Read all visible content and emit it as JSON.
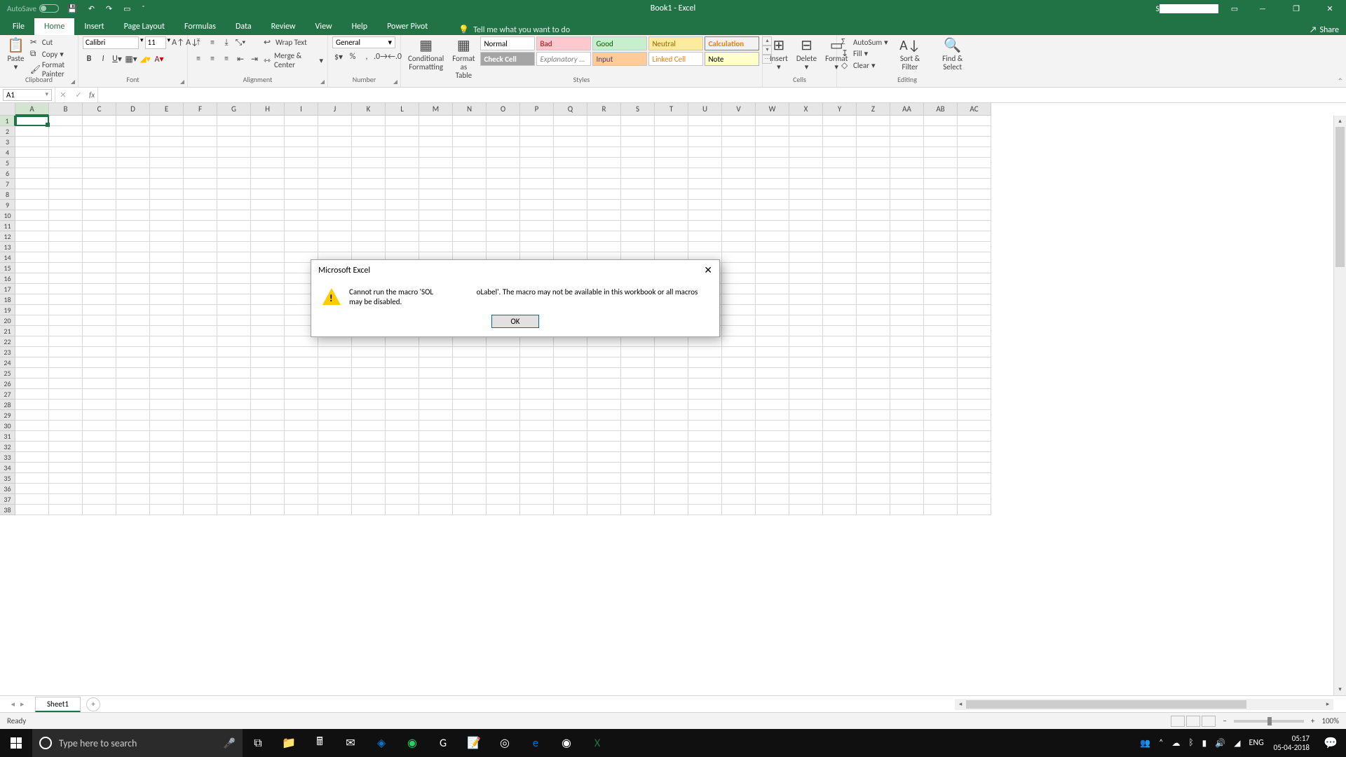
{
  "titlebar": {
    "autosave_label": "AutoSave",
    "title": "Book1 - Excel",
    "user_prefix": "S"
  },
  "tabs": {
    "file": "File",
    "home": "Home",
    "insert": "Insert",
    "page_layout": "Page Layout",
    "formulas": "Formulas",
    "data": "Data",
    "review": "Review",
    "view": "View",
    "help": "Help",
    "power_pivot": "Power Pivot",
    "tellme": "Tell me what you want to do",
    "share": "Share"
  },
  "ribbon": {
    "clipboard": {
      "label": "Clipboard",
      "paste": "Paste",
      "cut": "Cut",
      "copy": "Copy",
      "painter": "Format Painter"
    },
    "font": {
      "label": "Font",
      "name": "Calibri",
      "size": "11"
    },
    "alignment": {
      "label": "Alignment",
      "wrap": "Wrap Text",
      "merge": "Merge & Center"
    },
    "number": {
      "label": "Number",
      "format": "General"
    },
    "styles": {
      "label": "Styles",
      "cond": "Conditional Formatting",
      "table": "Format as Table",
      "normal": "Normal",
      "bad": "Bad",
      "good": "Good",
      "neutral": "Neutral",
      "calculation": "Calculation",
      "check": "Check Cell",
      "explanatory": "Explanatory ...",
      "input": "Input",
      "linked": "Linked Cell",
      "note": "Note"
    },
    "cells": {
      "label": "Cells",
      "insert": "Insert",
      "delete": "Delete",
      "format": "Format"
    },
    "editing": {
      "label": "Editing",
      "autosum": "AutoSum",
      "fill": "Fill",
      "clear": "Clear",
      "sort": "Sort & Filter",
      "find": "Find & Select"
    }
  },
  "namebox": "A1",
  "columns": [
    "A",
    "B",
    "C",
    "D",
    "E",
    "F",
    "G",
    "H",
    "I",
    "J",
    "K",
    "L",
    "M",
    "N",
    "O",
    "P",
    "Q",
    "R",
    "S",
    "T",
    "U",
    "V",
    "W",
    "X",
    "Y",
    "Z",
    "AA",
    "AB",
    "AC"
  ],
  "row_count": 38,
  "sheet": {
    "name": "Sheet1"
  },
  "status": {
    "ready": "Ready",
    "zoom": "100%"
  },
  "dialog": {
    "title": "Microsoft Excel",
    "msg_pre": "Cannot run the macro 'SOL",
    "msg_post": "oLabel'. The macro may not be available in this workbook or all macros may be disabled.",
    "ok": "OK"
  },
  "taskbar": {
    "search_placeholder": "Type here to search",
    "lang": "ENG",
    "time": "05:17",
    "date": "05-04-2018"
  }
}
